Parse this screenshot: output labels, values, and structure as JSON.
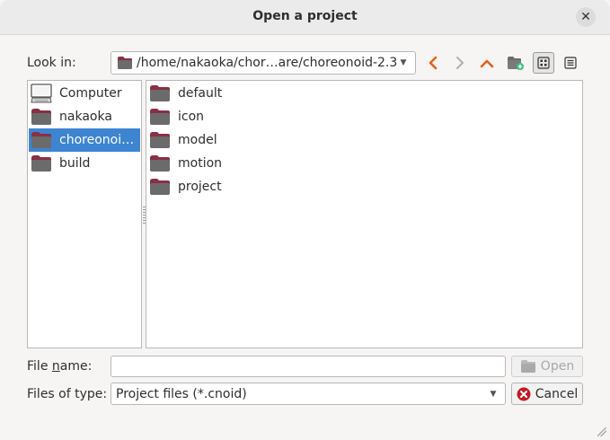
{
  "window": {
    "title": "Open a project",
    "close_glyph": "✕"
  },
  "look_in": {
    "label": "Look in:",
    "path": "/home/nakaoka/chor…are/choreonoid-2.3"
  },
  "toolbar": {
    "icons": [
      "back-icon",
      "forward-icon",
      "parent-dir-icon",
      "new-folder-icon",
      "list-mode-icon",
      "detail-mode-icon"
    ]
  },
  "sidebar": {
    "items": [
      {
        "label": "Computer",
        "icon": "computer-icon",
        "selected": false
      },
      {
        "label": "nakaoka",
        "icon": "folder-icon",
        "selected": false
      },
      {
        "label": "choreonoi…",
        "icon": "folder-icon",
        "selected": true
      },
      {
        "label": "build",
        "icon": "folder-icon",
        "selected": false
      }
    ]
  },
  "files": {
    "items": [
      {
        "label": "default"
      },
      {
        "label": "icon"
      },
      {
        "label": "model"
      },
      {
        "label": "motion"
      },
      {
        "label": "project"
      }
    ]
  },
  "file_name": {
    "label_before": "File ",
    "label_underlined": "n",
    "label_after": "ame:",
    "value": ""
  },
  "file_type": {
    "label": "Files of type:",
    "value": "Project files (*.cnoid)"
  },
  "buttons": {
    "open": "Open",
    "cancel": "Cancel"
  },
  "colors": {
    "selection": "#3d84d1",
    "folder_top": "#8a2f44",
    "folder_body": "#6b6b6b",
    "accent_orange": "#e8601c",
    "cancel_red": "#c01c28"
  }
}
